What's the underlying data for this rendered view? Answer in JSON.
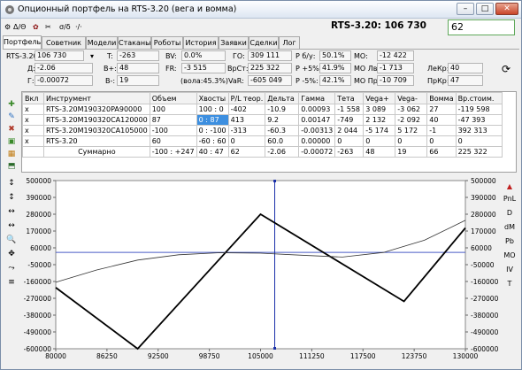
{
  "window": {
    "title": "Опционный портфель на RTS-3.20 (вега и вомма)",
    "minimize": "–",
    "maximize": "□",
    "close": "✕"
  },
  "toolbar": {
    "btn1": "Δ/Θ",
    "btn2": "σ/δ",
    "btn3": "·/·"
  },
  "headline": "RTS-3.20: 106 730",
  "bigbox_value": "62",
  "tabs": [
    "Портфель",
    "Советник",
    "Модели",
    "Стаканы",
    "Роботы",
    "История",
    "Заявки",
    "Сделки",
    "Лог"
  ],
  "params": {
    "asset_label": "RTS-3.20",
    "asset_value": "106 730",
    "delta_label": "Д:",
    "delta_value": "-2.06",
    "gamma_label": "Г:",
    "gamma_value": "-0.00072",
    "t_label": "T:",
    "t_value": "-263",
    "bplus_label": "B+:",
    "bplus_value": "48",
    "bminus_label": "B-:",
    "bminus_value": "19",
    "bv_label": "BV:",
    "bv_value": "0.0%",
    "fr_label": "FR:",
    "fr_value": "-3 515",
    "vola_note": "(вола:45.3%)",
    "go_label": "ГО:",
    "go_value": "309 111",
    "vrst_label": "ВрСт:",
    "vrst_value": "225 322",
    "var_label": "VaR:",
    "var_value": "-605 049",
    "pbu_label": "P б/у:",
    "pbu_value": "50.1%",
    "p5p_label": "P +5%:",
    "p5p_value": "41.9%",
    "p5m_label": "P -5%:",
    "p5m_value": "42.1%",
    "mo_label": "МО:",
    "mo_value": "-12 422",
    "mole_label": "МО Лв:",
    "mole_value": "-1 713",
    "mopr_label": "МО Пр:",
    "mopr_value": "-10 709",
    "lekr_label": "ЛеКр:",
    "lekr_value": "40",
    "prkr_label": "ПрКр:",
    "prkr_value": "47",
    "refresh": "⟳"
  },
  "table": {
    "headers": [
      "Вкл",
      "Инструмент",
      "Объем",
      "Хвосты",
      "P/L теор.",
      "Дельта",
      "Гамма",
      "Тета",
      "Vega+",
      "Vega-",
      "Вомма",
      "Вр.стоим."
    ],
    "rows": [
      [
        "x",
        "RTS-3.20M190320PA90000",
        "100",
        "100 : 0",
        "-402",
        "-10.9",
        "0.00093",
        "-1 558",
        "3 089",
        "-3 062",
        "27",
        "-119 598"
      ],
      [
        "x",
        "RTS-3.20M190320CA120000",
        "87",
        "0 : 87",
        "413",
        "9.2",
        "0.00147",
        "-749",
        "2 132",
        "-2 092",
        "40",
        "-47 393"
      ],
      [
        "x",
        "RTS-3.20M190320CA105000",
        "-100",
        "0 : -100",
        "-313",
        "-60.3",
        "-0.00313",
        "2 044",
        "-5 174",
        "5 172",
        "-1",
        "392 313"
      ],
      [
        "x",
        "RTS-3.20",
        "60",
        "-60 : 60",
        "0",
        "60.0",
        "0.00000",
        "0",
        "0",
        "0",
        "0",
        "0"
      ],
      [
        "",
        "Суммарно",
        "-100 : +247",
        "40 : 47",
        "62",
        "-2.06",
        "-0.00072",
        "-263",
        "48",
        "19",
        "66",
        "225 322"
      ]
    ]
  },
  "chart_data": {
    "type": "line",
    "x_ticks": [
      "80000",
      "86250",
      "92500",
      "98750",
      "105000",
      "111250",
      "117500",
      "123750",
      "130000"
    ],
    "y_ticks": [
      "500000",
      "390000",
      "280000",
      "170000",
      "60000",
      "-50000",
      "-160000",
      "-270000",
      "-380000",
      "-490000",
      "-600000"
    ],
    "xlim": [
      80000,
      130000
    ],
    "ylim": [
      -600000,
      500000
    ],
    "series": [
      {
        "color": "#000000",
        "points": [
          [
            80000,
            -200000
          ],
          [
            90000,
            -600000
          ],
          [
            105000,
            280000
          ],
          [
            122500,
            -290000
          ],
          [
            130000,
            190000
          ]
        ]
      },
      {
        "color": "#333333",
        "points": [
          [
            80000,
            -165000
          ],
          [
            85000,
            -85000
          ],
          [
            90000,
            -20000
          ],
          [
            95000,
            15000
          ],
          [
            100000,
            28000
          ],
          [
            105000,
            25000
          ],
          [
            110000,
            12000
          ],
          [
            115000,
            0
          ],
          [
            120000,
            30000
          ],
          [
            125000,
            110000
          ],
          [
            130000,
            240000
          ]
        ]
      }
    ],
    "baseline": 30000,
    "spot": 106730,
    "colors": {
      "axis_line": "#4a5cc7",
      "cursor": "#1a2fa8"
    }
  },
  "right_tools": [
    "PnL",
    "D",
    "dM",
    "Pb",
    "MO",
    "IV",
    "T"
  ],
  "left_tools_bottom": [
    "↕",
    "↕",
    "↔",
    "↔",
    "🔍",
    "✥",
    "⤳",
    "≡"
  ]
}
